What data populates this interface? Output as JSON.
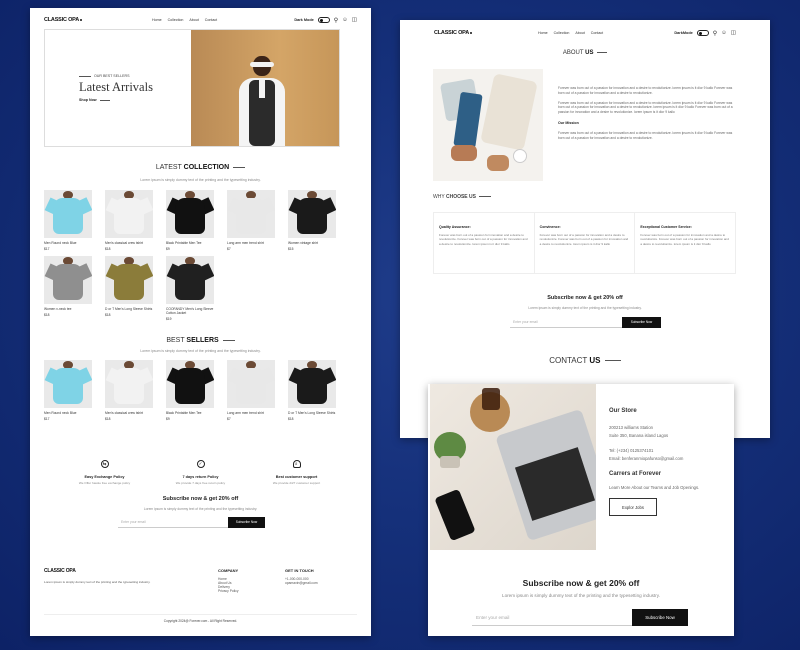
{
  "nav": {
    "logo": "CLASSIC OPA",
    "links": [
      "Home",
      "Collection",
      "About",
      "Contact"
    ],
    "dark_mode_label": "Dark Mode",
    "dark_mode_label_alt": "DarkMode",
    "search_icon": "search-icon",
    "profile_icon": "user-icon",
    "cart_icon": "cart-icon"
  },
  "hero": {
    "eyebrow": "OUR BEST SELLERS",
    "title": "Latest Arrivals",
    "cta": "Shop Now"
  },
  "latest": {
    "title_light": "LATEST",
    "title_bold": "COLLECTION",
    "subtitle": "Lorem ipsum is simply dummy text of the printing and the typesetting industry.",
    "products": [
      {
        "name": "Men Round neck Blue",
        "price": "$17"
      },
      {
        "name": "Men's classical crew tshirt",
        "price": "$18"
      },
      {
        "name": "Black Printable Men Tee",
        "price": "$9"
      },
      {
        "name": "Long arm men trend shirt",
        "price": "$7"
      },
      {
        "name": "Women vintage shirt",
        "price": "$15"
      },
      {
        "name": "Women v-neck tee",
        "price": "$18"
      },
      {
        "name": "D or T Men's Long Sleeve Shirts",
        "price": "$18"
      },
      {
        "name": "COOFANDY Men's Long Sleeve Cotton Jacket",
        "price": "$19"
      }
    ]
  },
  "best": {
    "title_light": "BEST",
    "title_bold": "SELLERS",
    "subtitle": "Lorem ipsum is simply dummy text of the printing and the typesetting industry.",
    "products": [
      {
        "name": "Men Round neck Blue",
        "price": "$17"
      },
      {
        "name": "Men's classical crew tshirt",
        "price": "$18"
      },
      {
        "name": "Black Printable Men Tee",
        "price": "$9"
      },
      {
        "name": "Long arm men trend shirt",
        "price": "$7"
      },
      {
        "name": "D or T Men's Long Sleeve Shirts",
        "price": "$18"
      }
    ]
  },
  "policies": [
    {
      "icon": "exchange-icon",
      "title": "Easy Exchange Policy",
      "desc": "We Offer hassle free exchange policy"
    },
    {
      "icon": "check-badge-icon",
      "title": "7 days return Policy",
      "desc": "We provide 7 days free return policy"
    },
    {
      "icon": "headset-icon",
      "title": "Best customer support",
      "desc": "We provide 24/7 customer support"
    }
  ],
  "subscribe": {
    "title": "Subscribe now & get 20% off",
    "subtitle": "Lorem ipsum is simply dummy text of the printing and the typesetting industry.",
    "placeholder": "Enter your email",
    "button": "Subscribe Now"
  },
  "footer": {
    "logo": "CLASSIC OPA",
    "desc": "Lorem ipsum is simply dummy text of the printing and the typesetting industry.",
    "company_title": "COMPANY",
    "company_links": [
      "Home",
      "About Us",
      "Delivery",
      "Privacy Policy"
    ],
    "contact_title": "GET IN TOUCH",
    "contact_lines": [
      "+1-000-000-000",
      "opamavin@gmail.com"
    ],
    "copyright": "Copyright 2024@ Forever.com - All Right Reserved."
  },
  "about": {
    "title_light": "ABOUT",
    "title_bold": "US",
    "p1": "Forever was born out of a passion for innovation and a desire to revolutionize. lorem ipsum is it dior 9 kallo Forever was born out of a passion for innovation and a desire to revolutionize.",
    "p2": "Forever was born out of a passion for innovation and a desire to revolutionize. lorem ipsum is it dior 9 kallo Forever was born out of a passion for innovation and a desire to revolutionize. lorem ipsum is it dior 9 kallo Forever was born out of a passion for innovation and a desire to revolutionize. lorem ipsum is it dior 9 kallo",
    "mission_title": "Our Mission",
    "p3": "Forever was born out of a passion for innovation and a desire to revolutionize. lorem ipsum is it dior 9 kallo Forever was born out of a passion for innovation and a desire to revolutionize."
  },
  "why": {
    "title_light": "WHY",
    "title_bold": "CHOOSE US",
    "items": [
      {
        "title": "Quality Assurance:",
        "desc": "Forever was born out of a passion for innovation and a desire to revolutionize. Forever was born out of a passion for innovation and a desire to revolutionize. lorem ipsum is it dior 9 kallo"
      },
      {
        "title": "Convinence:",
        "desc": "Forever was born out of a passion for innovation and a desire to revolutionize. Forever was born out of a passion for innovation and a desire to revolutionize. lorem ipsum is it dior 9 kallo"
      },
      {
        "title": "Exceptional Customer Service:",
        "desc": "Forever was born out of a passion for innovation and a desire to revolutionize. Forever was born out of a passion for innovation and a desire to revolutionize. lorem ipsum is it dior 9 kallo"
      }
    ]
  },
  "contact": {
    "title_light": "CONTACT",
    "title_bold": "US",
    "store_title": "Our Store",
    "address1": "200213 williams Station",
    "address2": "Suite 350, Banana island Lagos",
    "phone": "Tel: (+234) 0125374101",
    "email": "Email: benferanmiopafunso@gmail.com",
    "careers_title": "Carrers at Forever",
    "careers_desc": "Learn More About our Teams and Job Openings.",
    "explore_button": "Explor Jobs"
  }
}
